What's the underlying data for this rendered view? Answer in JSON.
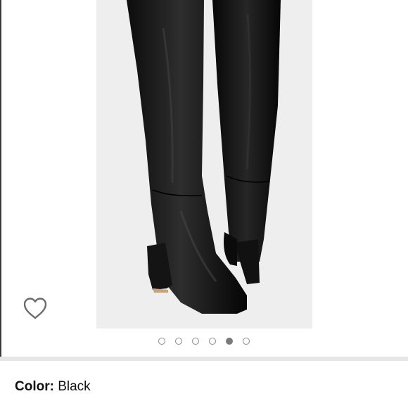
{
  "gallery": {
    "image_alt": "",
    "dot_count": 6,
    "active_dot_index": 4,
    "colors": {
      "background": "#eeeeee",
      "product": "#111111"
    }
  },
  "wishlist": {
    "icon": "heart-outline-icon"
  },
  "variation": {
    "label": "Color:",
    "value": "Black"
  }
}
